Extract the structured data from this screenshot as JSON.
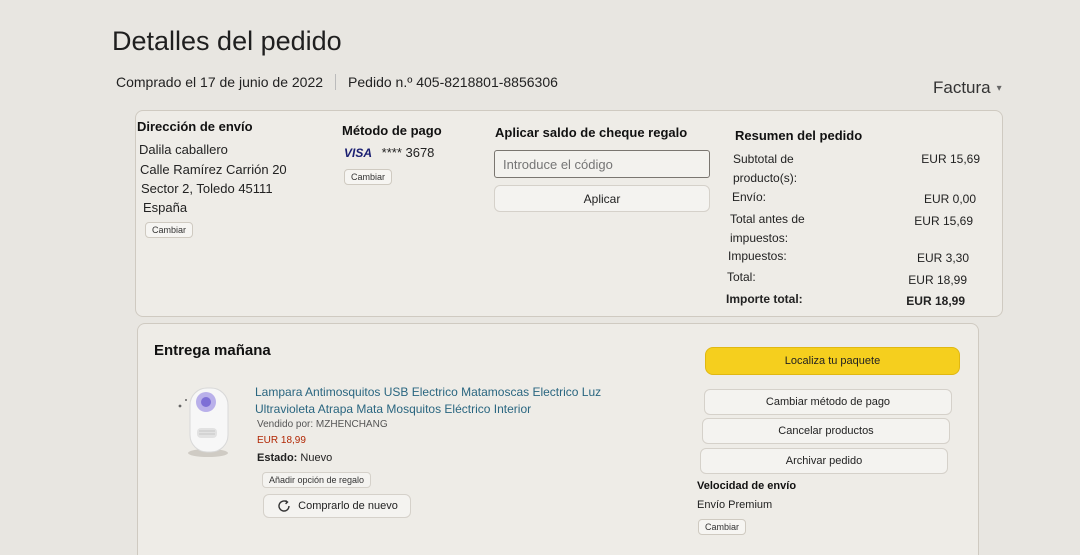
{
  "header": {
    "title": "Detalles del pedido",
    "purchased": "Comprado el 17 de junio de 2022",
    "order_number": "Pedido n.º 405-8218801-8856306",
    "invoice": "Factura"
  },
  "shipping": {
    "heading": "Dirección de envío",
    "lines": [
      "Dalila caballero",
      "Calle Ramírez Carrión 20",
      "Sector 2, Toledo 45111",
      "España"
    ],
    "change": "Cambiar"
  },
  "payment": {
    "heading": "Método de pago",
    "card_brand": "VISA",
    "card_number": "**** 3678",
    "change": "Cambiar"
  },
  "gift_card": {
    "heading": "Aplicar saldo de cheque regalo",
    "placeholder": "Introduce el código",
    "apply": "Aplicar"
  },
  "summary": {
    "heading": "Resumen del pedido",
    "rows": [
      {
        "label": "Subtotal de\nproducto(s):",
        "value": "EUR 15,69"
      },
      {
        "label": "Envío:",
        "value": "EUR 0,00"
      },
      {
        "label": "Total antes de\nimpuestos:",
        "value": "EUR 15,69"
      },
      {
        "label": "Impuestos:",
        "value": "EUR 3,30"
      },
      {
        "label": "Total:",
        "value": "EUR 18,99"
      },
      {
        "label": "Importe total:",
        "value": "EUR 18,99"
      }
    ]
  },
  "delivery": {
    "heading": "Entrega mañana",
    "track": "Localiza tu paquete",
    "change_payment": "Cambiar método de pago",
    "cancel": "Cancelar productos",
    "archive": "Archivar pedido",
    "speed_heading": "Velocidad de envío",
    "speed_value": "Envío Premium",
    "speed_change": "Cambiar"
  },
  "product": {
    "title": "Lampara Antimosquitos USB Electrico Matamoscas Electrico Luz Ultravioleta Atrapa Mata Mosquitos Eléctrico Interior",
    "seller": "Vendido por: MZHENCHANG",
    "price": "EUR 18,99",
    "estado_label": "Estado:",
    "estado_value": "Nuevo",
    "gift_option": "Añadir opción de regalo",
    "buy_again": "Comprarlo de nuevo"
  },
  "colors": {
    "track_button": "#f5cf1e",
    "product_link": "#2a6680",
    "price": "#b12704"
  }
}
